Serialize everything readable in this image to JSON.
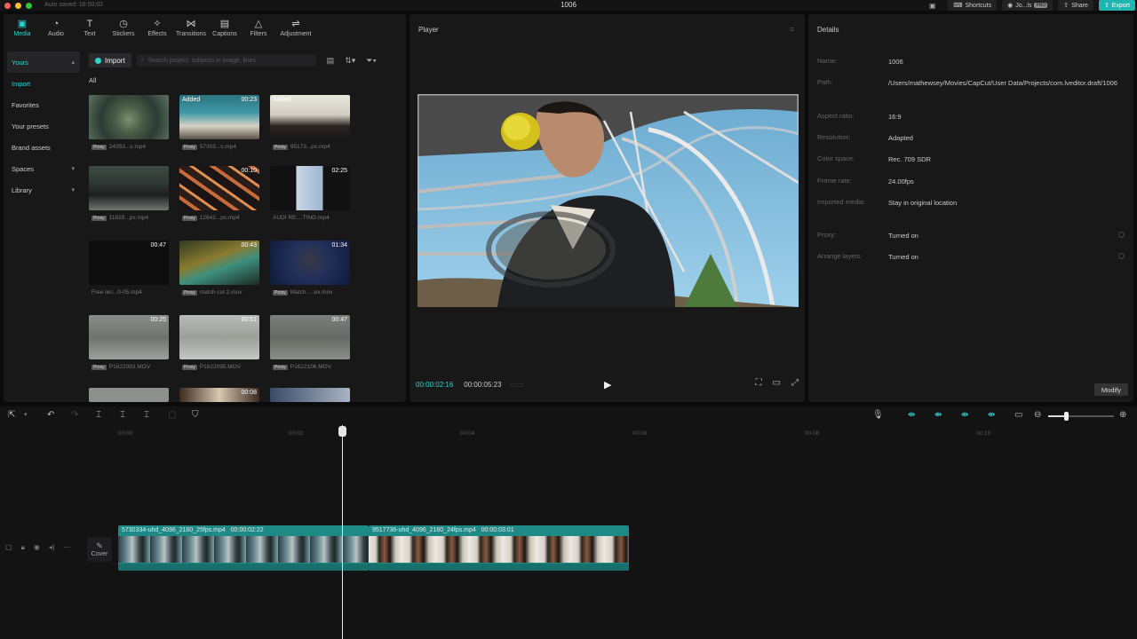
{
  "titlebar": {
    "autosave": "Auto saved: 16:50:02",
    "title": "1006",
    "shortcuts": "Shortcuts",
    "user": "Jo...ls",
    "share": "Share",
    "export": "Export"
  },
  "toolbar_tabs": [
    {
      "label": "Media",
      "icon": "▣"
    },
    {
      "label": "Audio",
      "icon": "◔"
    },
    {
      "label": "Text",
      "icon": "T"
    },
    {
      "label": "Stickers",
      "icon": "◷"
    },
    {
      "label": "Effects",
      "icon": "✧"
    },
    {
      "label": "Transitions",
      "icon": "⋈"
    },
    {
      "label": "Captions",
      "icon": "▤"
    },
    {
      "label": "Filters",
      "icon": "△"
    },
    {
      "label": "Adjustment",
      "icon": "⇌"
    }
  ],
  "sidebar": {
    "yours": "Yours",
    "import": "Import",
    "favorites": "Favorites",
    "presets": "Your presets",
    "brand": "Brand assets",
    "spaces": "Spaces",
    "library": "Library"
  },
  "media": {
    "import_label": "Import",
    "search_placeholder": "Search project, subjects in image, lines",
    "all_label": "All",
    "items": [
      {
        "added": "",
        "duration": "",
        "name": "24353...s.mp4",
        "tag": "Proxy"
      },
      {
        "added": "Added",
        "duration": "00:23",
        "name": "57303...s.mp4",
        "tag": "Proxy"
      },
      {
        "added": "Added",
        "duration": "",
        "name": "95173...ps.mp4",
        "tag": "Proxy"
      },
      {
        "added": "",
        "duration": "",
        "name": "11828...ps.mp4",
        "tag": "Proxy"
      },
      {
        "added": "",
        "duration": "00:10",
        "name": "12641...ps.mp4",
        "tag": "Proxy"
      },
      {
        "added": "",
        "duration": "02:25",
        "name": "AUDI RE....TING.mp4",
        "tag": ""
      },
      {
        "added": "",
        "duration": "00:47",
        "name": "Free len...0-05.mp4",
        "tag": ""
      },
      {
        "added": "",
        "duration": "00:43",
        "name": "match cut 2.mov",
        "tag": "Proxy"
      },
      {
        "added": "",
        "duration": "01:34",
        "name": "Match ....ex.mov",
        "tag": "Proxy"
      },
      {
        "added": "",
        "duration": "00:25",
        "name": "P1622093.MOV",
        "tag": "Proxy"
      },
      {
        "added": "",
        "duration": "00:51",
        "name": "P1622095.MOV",
        "tag": "Proxy"
      },
      {
        "added": "",
        "duration": "00:47",
        "name": "P1622106.MOV",
        "tag": "Proxy"
      },
      {
        "added": "",
        "duration": "",
        "name": "",
        "tag": ""
      },
      {
        "added": "",
        "duration": "00:08",
        "name": "",
        "tag": ""
      },
      {
        "added": "",
        "duration": "",
        "name": "",
        "tag": ""
      }
    ]
  },
  "player": {
    "title": "Player",
    "current_time": "00:00:02:16",
    "total_time": "00:00:05:23"
  },
  "details": {
    "title": "Details",
    "rows": [
      {
        "label": "Name:",
        "value": "1006"
      },
      {
        "label": "Path:",
        "value": "/Users/mathewsey/Movies/CapCut/User Data/Projects/com.lveditor.draft/1006"
      },
      {
        "label": "Aspect ratio:",
        "value": "16:9"
      },
      {
        "label": "Resolution:",
        "value": "Adapted"
      },
      {
        "label": "Color space:",
        "value": "Rec. 709 SDR"
      },
      {
        "label": "Frame rate:",
        "value": "24.00fps"
      },
      {
        "label": "Imported media:",
        "value": "Stay in original location"
      },
      {
        "label": "Proxy:",
        "value": "Turned on"
      },
      {
        "label": "Arrange layers",
        "value": "Turned on"
      }
    ],
    "modify": "Modify"
  },
  "timeline": {
    "ruler": [
      "00:00",
      "00:02",
      "00:04",
      "00:06",
      "00:08",
      "00:10"
    ],
    "cover": "Cover",
    "clips": [
      {
        "name": "5730334-uhd_4096_2160_25fps.mp4",
        "duration": "00:00:02:22"
      },
      {
        "name": "9517736-uhd_4096_2160_24fps.mp4",
        "duration": "00:00:03:01"
      }
    ]
  },
  "colors": {
    "accent": "#2bd5cf",
    "clip": "#1e8a86",
    "panel": "#181819"
  }
}
